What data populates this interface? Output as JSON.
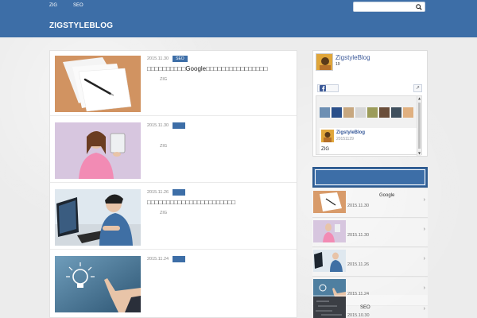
{
  "nav": {
    "items": [
      "ZIG",
      "SEO"
    ]
  },
  "search": {
    "placeholder": ""
  },
  "site": {
    "title": "ZIGSTYLEBLOG"
  },
  "posts": [
    {
      "date": "2015.11.30",
      "category": "SEO",
      "title": "□□□□□□□□□□Google□□□□□□□□□□□□□□□□",
      "author": "ZIG"
    },
    {
      "date": "2015.11.30",
      "category": "",
      "title": "",
      "author": "ZIG"
    },
    {
      "date": "2015.11.26",
      "category": "",
      "title": "□□□□□□□□□□□□□□□□□□□□□□□",
      "author": "ZIG"
    },
    {
      "date": "2015.11.24",
      "category": "",
      "title": "",
      "author": ""
    }
  ],
  "facebook": {
    "page_name": "ZigstyleBlog",
    "count": "19",
    "share_label": "↗",
    "post_name": "ZigstyleBlog",
    "post_date": "20151129",
    "post_text": "ZIG"
  },
  "popular": {
    "heading": "",
    "items": [
      {
        "title": "Google",
        "date": "2015.11.30"
      },
      {
        "title": "",
        "date": "2015.11.30"
      },
      {
        "title": "",
        "date": "2015.11.26"
      },
      {
        "title": "",
        "date": "2015.11.24"
      },
      {
        "title": "SEO",
        "date": "2015.10.30"
      }
    ]
  },
  "colors": {
    "header": "#3d6ea7",
    "accent": "#3d6ea7",
    "background": "#ececec"
  }
}
